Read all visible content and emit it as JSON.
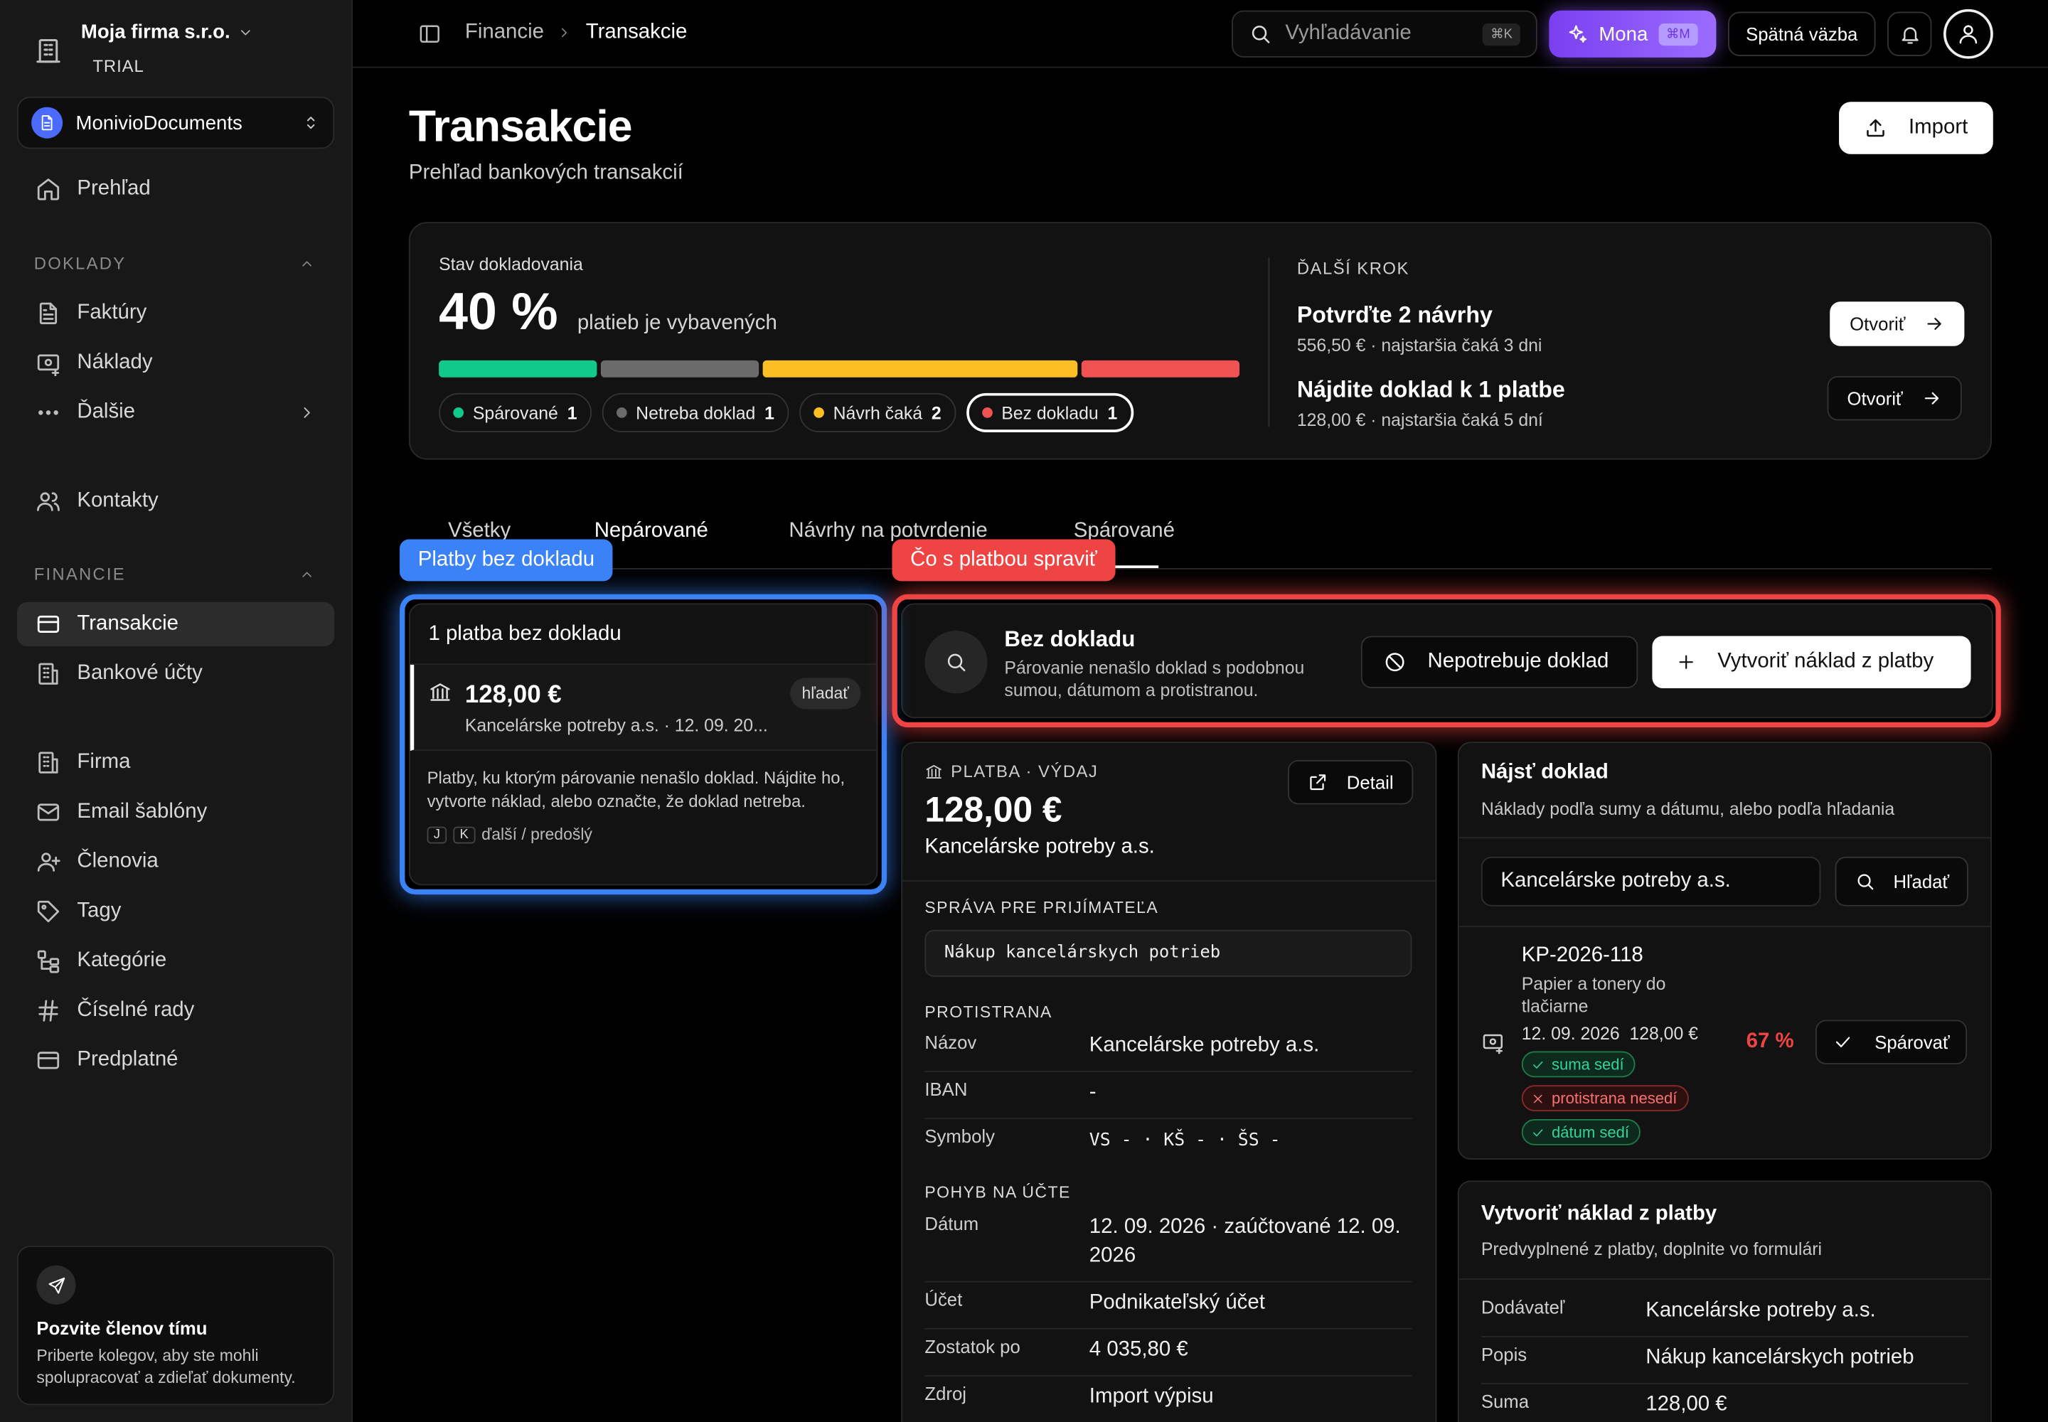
{
  "org": {
    "name": "Moja firma s.r.o.",
    "plan": "TRIAL"
  },
  "workspace": {
    "name": "MonivioDocuments"
  },
  "sidebar": {
    "overview": "Prehľad",
    "sections": {
      "doklady": "DOKLADY",
      "financie": "FINANCIE"
    },
    "doklady": [
      "Faktúry",
      "Náklady",
      "Ďalšie"
    ],
    "contacts": "Kontakty",
    "financie": [
      "Transakcie",
      "Bankové účty"
    ],
    "other": [
      "Firma",
      "Email šablóny",
      "Členovia",
      "Tagy",
      "Kategórie",
      "Číselné rady",
      "Predplatné"
    ],
    "invite": {
      "title": "Pozvite členov tímu",
      "text": "Priberte kolegov, aby ste mohli spolupracovať a zdieľať dokumenty."
    }
  },
  "topbar": {
    "breadcrumb": [
      "Financie",
      "Transakcie"
    ],
    "search_placeholder": "Vyhľadávanie",
    "search_kbd": "⌘K",
    "mona": "Mona",
    "mona_kbd": "⌘M",
    "feedback": "Spätná väzba"
  },
  "page": {
    "title": "Transakcie",
    "subtitle": "Prehľad bankových transakcií",
    "import": "Import"
  },
  "status": {
    "label": "Stav dokladovania",
    "percent": "40 %",
    "percent_desc": "platieb je vybavených",
    "bar": [
      {
        "color": "#10c98a",
        "value": 1
      },
      {
        "color": "#6b6b6b",
        "value": 1
      },
      {
        "color": "#fbbf24",
        "value": 2
      },
      {
        "color": "#f05252",
        "value": 1
      }
    ],
    "pills": [
      {
        "label": "Spárované",
        "count": "1",
        "color": "#10c98a"
      },
      {
        "label": "Netreba doklad",
        "count": "1",
        "color": "#6b6b6b"
      },
      {
        "label": "Návrh čaká",
        "count": "2",
        "color": "#fbbf24"
      },
      {
        "label": "Bez dokladu",
        "count": "1",
        "color": "#f05252"
      }
    ],
    "next_label": "ĎALŠÍ KROK",
    "tasks": [
      {
        "title": "Potvrďte 2 návrhy",
        "desc": "556,50 € · najstaršia čaká 3 dni",
        "btn": "Otvoriť"
      },
      {
        "title": "Nájdite doklad k 1 platbe",
        "desc": "128,00 € · najstaršia čaká 5 dní",
        "btn": "Otvoriť"
      }
    ]
  },
  "tabs": [
    "Všetky",
    "Nepárované",
    "Návrhy na potvrdenie",
    "Spárované"
  ],
  "highlights": {
    "left": "Platby bez dokladu",
    "right": "Čo s platbou spraviť"
  },
  "list": {
    "header": "1 platba bez dokladu",
    "row": {
      "amount": "128,00 €",
      "who": "Kancelárske potreby a.s. · 12. 09. 20...",
      "tag": "hľadať"
    },
    "info": "Platby, ku ktorým párovanie nenašlo doklad. Nájdite ho, vytvorte náklad, alebo označte, že doklad netreba.",
    "keys": [
      "J",
      "K"
    ],
    "keys_label": "ďalší / predošlý"
  },
  "action": {
    "title": "Bez dokladu",
    "desc": "Párovanie nenašlo doklad s podobnou sumou, dátumom a protistranou.",
    "not_needed": "Nepotrebuje doklad",
    "create": "Vytvoriť náklad z platby"
  },
  "detail": {
    "type": "PLATBA · VÝDAJ",
    "amount": "128,00 €",
    "counterparty": "Kancelárske potreby a.s.",
    "detail_btn": "Detail",
    "msg_label": "SPRÁVA PRE PRIJÍMATEĽA",
    "msg": "Nákup kancelárskych potrieb",
    "cp_label": "PROTISTRANA",
    "name_k": "Názov",
    "name_v": "Kancelárske potreby a.s.",
    "iban_k": "IBAN",
    "iban_v": "-",
    "sym_k": "Symboly",
    "sym_v": "VS - · KŠ - · ŠS -",
    "move_label": "POHYB NA ÚČTE",
    "date_k": "Dátum",
    "date_v": "12. 09. 2026 · zaúčtované 12. 09. 2026",
    "acc_k": "Účet",
    "acc_v": "Podnikateľský účet",
    "bal_k": "Zostatok po",
    "bal_v": "4 035,80 €",
    "src_k": "Zdroj",
    "src_v": "Import výpisu"
  },
  "find": {
    "title": "Nájsť doklad",
    "desc": "Náklady podľa sumy a dátumu, alebo podľa hľadania",
    "query": "Kancelárske potreby a.s.",
    "search_btn": "Hľadať",
    "candidate": {
      "id": "KP-2026-118",
      "desc": "Papier a tonery do tlačiarne",
      "meta": "12. 09. 2026  128,00 €",
      "score": "67 %",
      "pair_btn": "Spárovať",
      "chips": [
        {
          "label": "suma sedí",
          "ok": true
        },
        {
          "label": "protistrana nesedí",
          "ok": false
        },
        {
          "label": "dátum sedí",
          "ok": true
        }
      ]
    }
  },
  "create": {
    "title": "Vytvoriť náklad z platby",
    "desc": "Predvyplnené z platby, doplnite vo formulári",
    "supplier_k": "Dodávateľ",
    "supplier_v": "Kancelárske potreby a.s.",
    "desc_k": "Popis",
    "desc_v": "Nákup kancelárskych potrieb",
    "sum_k": "Suma",
    "sum_v": "128,00 €"
  }
}
